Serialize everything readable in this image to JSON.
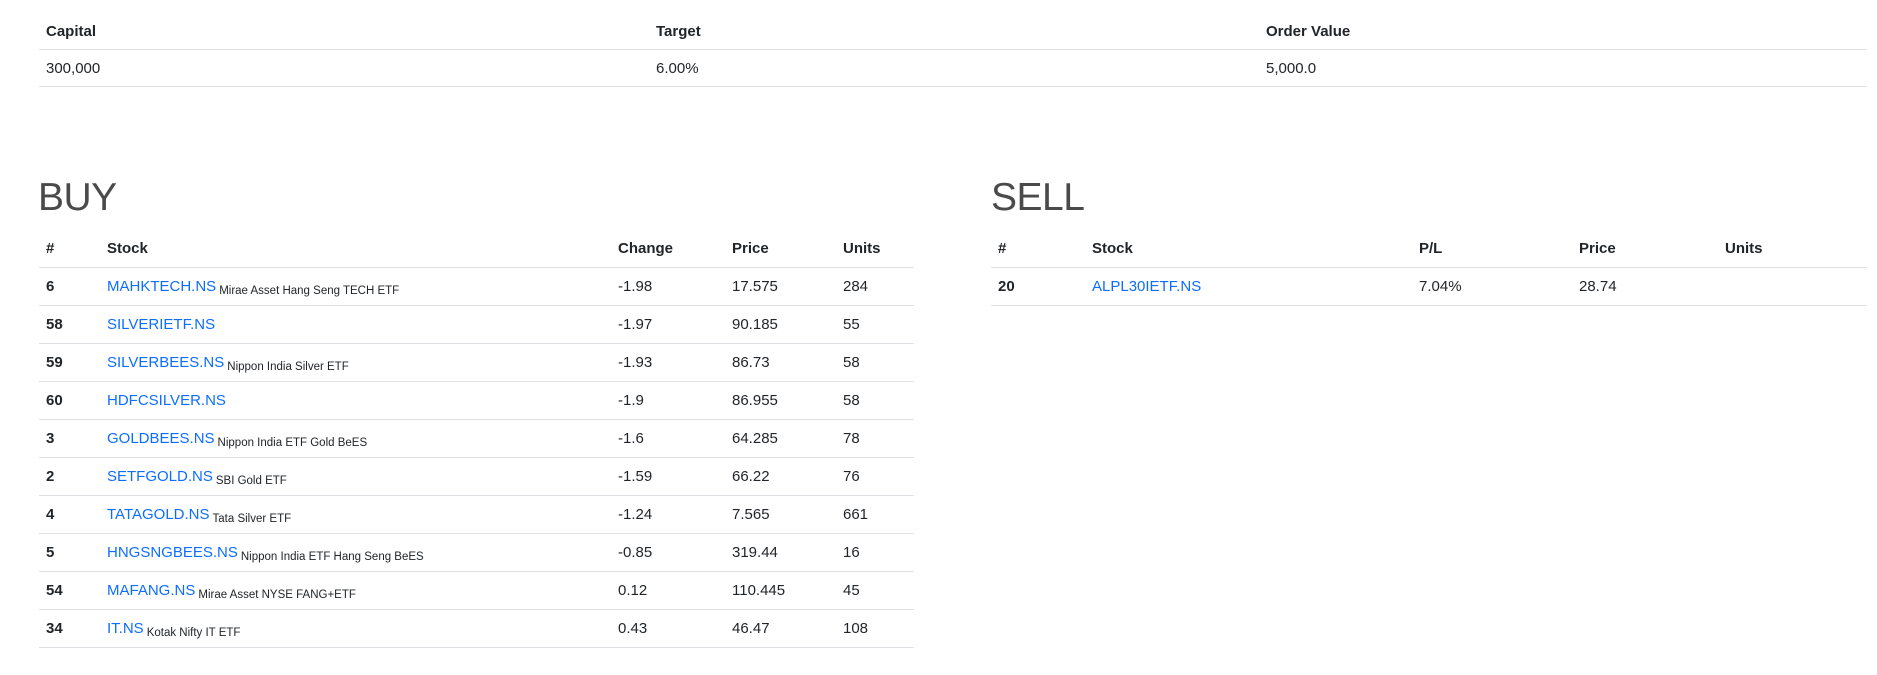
{
  "summary": {
    "headers": {
      "capital": "Capital",
      "target": "Target",
      "order_value": "Order Value"
    },
    "values": {
      "capital": "300,000",
      "target": "6.00%",
      "order_value": "5,000.0"
    }
  },
  "buy": {
    "title": "BUY",
    "headers": {
      "num": "#",
      "stock": "Stock",
      "change": "Change",
      "price": "Price",
      "units": "Units"
    },
    "rows": [
      {
        "num": "6",
        "symbol": "MAHKTECH.NS",
        "name": "Mirae Asset Hang Seng TECH ETF",
        "change": "-1.98",
        "price": "17.575",
        "units": "284"
      },
      {
        "num": "58",
        "symbol": "SILVERIETF.NS",
        "name": "",
        "change": "-1.97",
        "price": "90.185",
        "units": "55"
      },
      {
        "num": "59",
        "symbol": "SILVERBEES.NS",
        "name": "Nippon India Silver ETF",
        "change": "-1.93",
        "price": "86.73",
        "units": "58"
      },
      {
        "num": "60",
        "symbol": "HDFCSILVER.NS",
        "name": "",
        "change": "-1.9",
        "price": "86.955",
        "units": "58"
      },
      {
        "num": "3",
        "symbol": "GOLDBEES.NS",
        "name": "Nippon India ETF Gold BeES",
        "change": "-1.6",
        "price": "64.285",
        "units": "78"
      },
      {
        "num": "2",
        "symbol": "SETFGOLD.NS",
        "name": "SBI Gold ETF",
        "change": "-1.59",
        "price": "66.22",
        "units": "76"
      },
      {
        "num": "4",
        "symbol": "TATAGOLD.NS",
        "name": "Tata Silver ETF",
        "change": "-1.24",
        "price": "7.565",
        "units": "661"
      },
      {
        "num": "5",
        "symbol": "HNGSNGBEES.NS",
        "name": "Nippon India ETF Hang Seng BeES",
        "change": "-0.85",
        "price": "319.44",
        "units": "16"
      },
      {
        "num": "54",
        "symbol": "MAFANG.NS",
        "name": "Mirae Asset NYSE FANG+ETF",
        "change": "0.12",
        "price": "110.445",
        "units": "45"
      },
      {
        "num": "34",
        "symbol": "IT.NS",
        "name": "Kotak Nifty IT ETF",
        "change": "0.43",
        "price": "46.47",
        "units": "108"
      }
    ]
  },
  "sell": {
    "title": "SELL",
    "headers": {
      "num": "#",
      "stock": "Stock",
      "pl": "P/L",
      "price": "Price",
      "units": "Units"
    },
    "rows": [
      {
        "num": "20",
        "symbol": "ALPL30IETF.NS",
        "name": "",
        "pl": "7.04%",
        "price": "28.74",
        "units": ""
      }
    ]
  },
  "colors": {
    "link": "#0d6efd",
    "border": "#dee2e6",
    "text": "#212529",
    "heading": "#4a4a4a"
  }
}
